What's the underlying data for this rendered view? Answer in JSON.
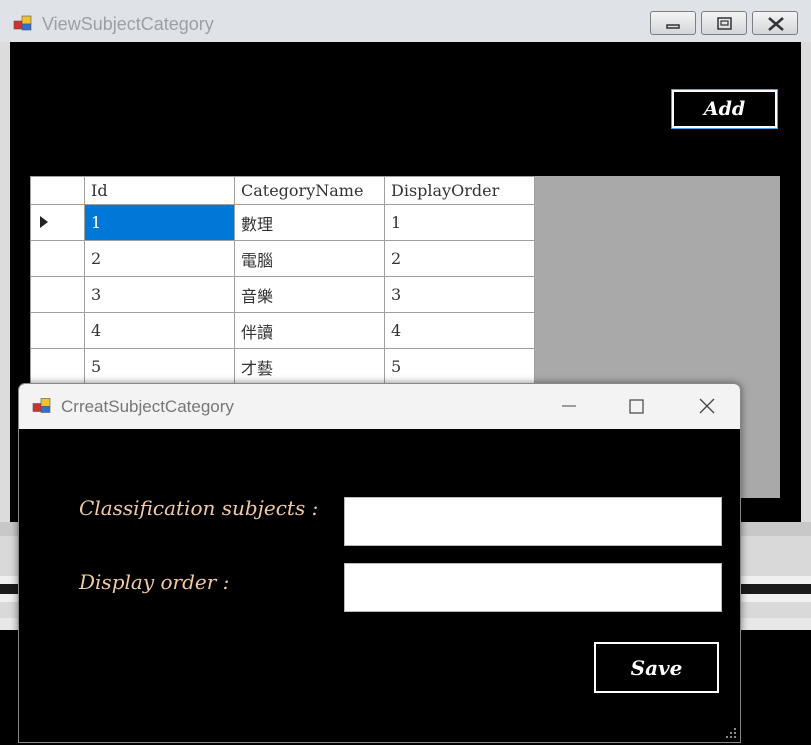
{
  "back_window": {
    "title": "ViewSubjectCategory",
    "add_label": "Add",
    "grid": {
      "columns": [
        "Id",
        "CategoryName",
        "DisplayOrder"
      ],
      "rows": [
        {
          "id": "1",
          "name": "數理",
          "order": "1"
        },
        {
          "id": "2",
          "name": "電腦",
          "order": "2"
        },
        {
          "id": "3",
          "name": "音樂",
          "order": "3"
        },
        {
          "id": "4",
          "name": "伴讀",
          "order": "4"
        },
        {
          "id": "5",
          "name": "才藝",
          "order": "5"
        }
      ]
    }
  },
  "dialog": {
    "title": "CrreatSubjectCategory",
    "classification_label": "Classification subjects :",
    "display_order_label": "Display order :",
    "classification_value": "",
    "display_order_value": "",
    "save_label": "Save"
  },
  "colors": {
    "selection": "#0078d7",
    "label_text": "#f1c9a4",
    "grid_background": "#a9a9a9"
  }
}
